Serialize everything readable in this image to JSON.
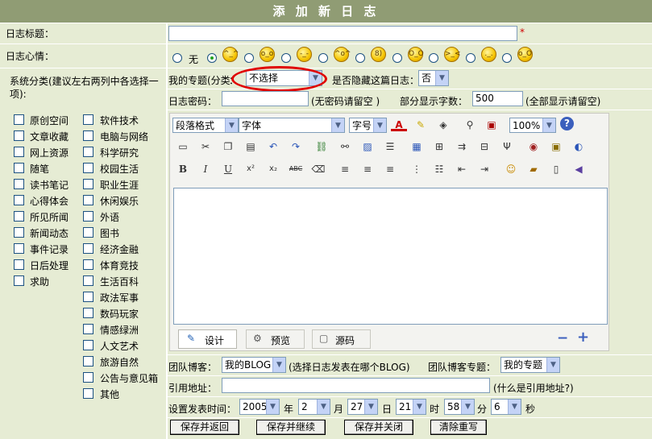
{
  "page_title": "添 加 新 日 志",
  "log_title": {
    "label": "日志标题：",
    "value": "",
    "required_mark": "*"
  },
  "mood": {
    "label": "日志心情：",
    "none_label": "无",
    "selected_index": 1,
    "faces": [
      "^_^",
      "o_o",
      "-_-",
      "^o^",
      "8)",
      "O_O",
      ">_<",
      "._.",
      "o_O"
    ]
  },
  "category": {
    "hint": "系统分类(建议左右两列中各选择一项):",
    "left": [
      "原创空间",
      "文章收藏",
      "网上资源",
      "随笔",
      "读书笔记",
      "心得体会",
      "所见所闻",
      "新闻动态",
      "事件记录",
      "日后处理",
      "求助"
    ],
    "right": [
      "软件技术",
      "电脑与网络",
      "科学研究",
      "校园生活",
      "职业生涯",
      "休闲娱乐",
      "外语",
      "图书",
      "经济金融",
      "体育竞技",
      "生活百科",
      "政法军事",
      "数码玩家",
      "情感绿洲",
      "人文艺术",
      "旅游自然",
      "公告与意见箱",
      "其他"
    ]
  },
  "topic": {
    "label": "我的专题(分类",
    "colon": "：",
    "value": "不选择"
  },
  "hide": {
    "label": "是否隐藏这篇日志：",
    "value": "否"
  },
  "password": {
    "label": "日志密码：",
    "value": "",
    "hint": "(无密码请留空 )"
  },
  "partial": {
    "label": "部分显示字数：",
    "value": "500",
    "hint": "(全部显示请留空)"
  },
  "editor": {
    "format_select": "段落格式",
    "font_select": "字体",
    "size_select": "字号",
    "zoom_select": "100%",
    "tabs": {
      "design": "设计",
      "preview": "预览",
      "source": "源码"
    }
  },
  "team": {
    "label": "团队博客：",
    "value": "我的BLOG",
    "hint": "(选择日志发表在哪个BLOG)",
    "topic_label": "团队博客专题：",
    "topic_value": "我的专题"
  },
  "cite": {
    "label": "引用地址：",
    "value": "",
    "hint": "(什么是引用地址?)"
  },
  "publish_time": {
    "label": "设置发表时间：",
    "year": "2005",
    "year_unit": "年",
    "month": "2",
    "month_unit": "月",
    "day": "27",
    "day_unit": "日",
    "hour": "21",
    "hour_unit": "时",
    "minute": "58",
    "minute_unit": "分",
    "second": "6",
    "second_unit": "秒"
  },
  "buttons": {
    "save_return": "保存并返回",
    "save_continue": "保存并继续",
    "save_close": "保存并关闭",
    "clear": "清除重写"
  },
  "colors": {
    "title_bg": "#909c74",
    "row_bg": "#e6ecd4",
    "highlight": "#e00000"
  }
}
